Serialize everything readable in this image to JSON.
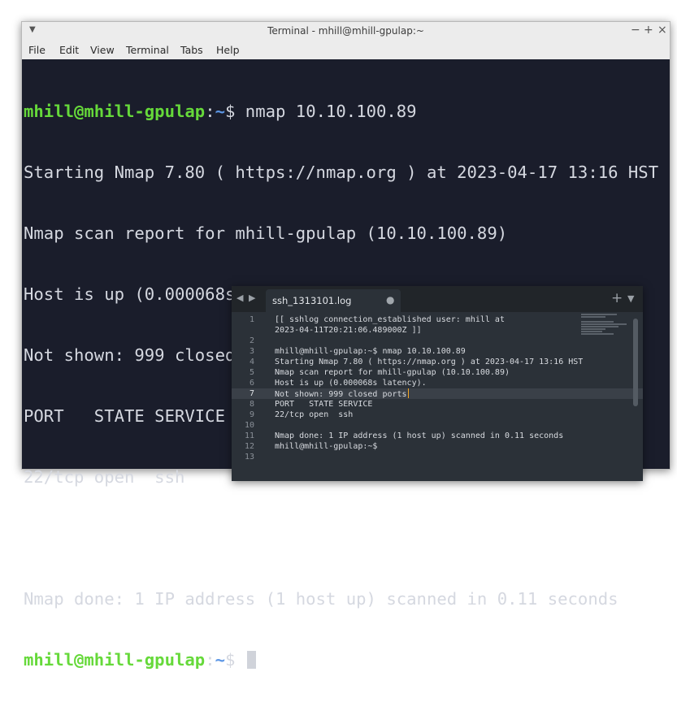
{
  "terminal": {
    "title": "Terminal - mhill@mhill-gpulap:~",
    "controls": {
      "minimize": "−",
      "maximize": "+",
      "close": "×"
    },
    "menu": [
      "File",
      "Edit",
      "View",
      "Terminal",
      "Tabs",
      "Help"
    ],
    "prompt": {
      "user_host": "mhill@mhill-gpulap",
      "sep": ":",
      "path": "~",
      "symbol": "$"
    },
    "command": " nmap 10.10.100.89",
    "output": [
      "Starting Nmap 7.80 ( https://nmap.org ) at 2023-04-17 13:16 HST",
      "Nmap scan report for mhill-gpulap (10.10.100.89)",
      "Host is up (0.000068s latency).",
      "Not shown: 999 closed ports",
      "PORT   STATE SERVICE",
      "22/tcp open  ssh",
      "",
      "Nmap done: 1 IP address (1 host up) scanned in 0.11 seconds"
    ],
    "final_prompt_suffix": " "
  },
  "editor": {
    "tab_label": "ssh_1313101.log",
    "tab_dot": "●",
    "plus": "+",
    "dropdown": "▼",
    "nav_left": "◀",
    "nav_right": "▶",
    "lines": [
      {
        "num": "1",
        "text": "[[ sshlog connection_established user: mhill at"
      },
      {
        "num": "",
        "text": "2023-04-11T20:21:06.489000Z ]]"
      },
      {
        "num": "2",
        "text": ""
      },
      {
        "num": "3",
        "text": "mhill@mhill-gpulap:~$ nmap 10.10.100.89"
      },
      {
        "num": "4",
        "text": "Starting Nmap 7.80 ( https://nmap.org ) at 2023-04-17 13:16 HST"
      },
      {
        "num": "5",
        "text": "Nmap scan report for mhill-gpulap (10.10.100.89)"
      },
      {
        "num": "6",
        "text": "Host is up (0.000068s latency)."
      },
      {
        "num": "7",
        "text": "Not shown: 999 closed ports"
      },
      {
        "num": "8",
        "text": "PORT   STATE SERVICE"
      },
      {
        "num": "9",
        "text": "22/tcp open  ssh"
      },
      {
        "num": "10",
        "text": ""
      },
      {
        "num": "11",
        "text": "Nmap done: 1 IP address (1 host up) scanned in 0.11 seconds"
      },
      {
        "num": "12",
        "text": "mhill@mhill-gpulap:~$"
      },
      {
        "num": "13",
        "text": ""
      }
    ],
    "active_line": "7"
  },
  "colors": {
    "terminal_bg": "#1a1d2b",
    "prompt_user": "#66d93a",
    "prompt_path": "#5d97e6",
    "editor_bg": "#2b3138",
    "caret": "#f5a623"
  }
}
